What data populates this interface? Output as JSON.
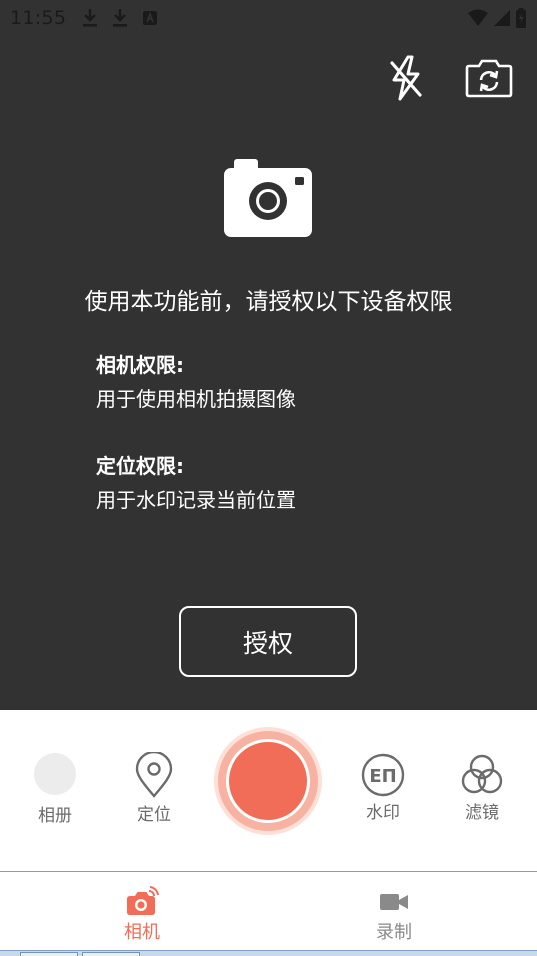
{
  "status_bar": {
    "time": "11:55",
    "notifications": [
      "download-icon",
      "download-icon",
      "app-notification-icon"
    ],
    "indicators": [
      "wifi-icon",
      "cellular-signal-icon",
      "battery-charging-icon"
    ]
  },
  "top_controls": {
    "flash_icon": "flash-off-icon",
    "switch_icon": "switch-camera-icon"
  },
  "permission": {
    "icon": "camera-icon",
    "title": "使用本功能前，请授权以下设备权限",
    "camera": {
      "heading": "相机权限:",
      "description": "用于使用相机拍摄图像"
    },
    "location": {
      "heading": "定位权限:",
      "description": "用于水印记录当前位置"
    },
    "grant_button": "授权"
  },
  "controls": {
    "album_label": "相册",
    "location_label": "定位",
    "watermark_label": "水印",
    "watermark_glyph": "EП",
    "filter_label": "滤镜"
  },
  "tabs": [
    {
      "label": "相机",
      "icon": "camera-tab-icon",
      "active": true
    },
    {
      "label": "录制",
      "icon": "video-camera-icon",
      "active": false
    }
  ],
  "colors": {
    "background": "#323232",
    "accent": "#f26d57",
    "shutter_halo": "#fde0d8",
    "inactive_text": "#8a8a8a"
  }
}
